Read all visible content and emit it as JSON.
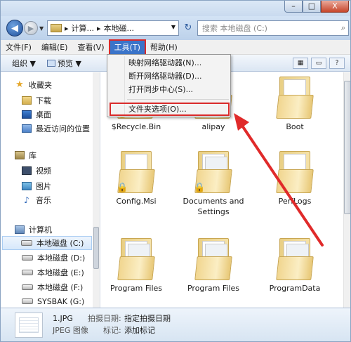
{
  "window": {
    "buttons": {
      "minimize": "–",
      "maximize": "□",
      "close": "X"
    }
  },
  "navigation": {
    "back": "◀",
    "forward": "▶",
    "address_parts": [
      "计算...",
      "本地磁..."
    ],
    "separator": "▸",
    "refresh": "↻",
    "search_placeholder": "搜索 本地磁盘 (C:)",
    "search_icon": "magnifier-icon"
  },
  "menubar": {
    "items": [
      "文件(F)",
      "编辑(E)",
      "查看(V)",
      "工具(T)",
      "帮助(H)"
    ],
    "active_index": 3
  },
  "toolbar": {
    "organize": "组织 ▼",
    "preview": "预览 ▼",
    "views_icon": "▦",
    "help_icon": "?"
  },
  "tools_menu": {
    "items": [
      "映射网络驱动器(N)...",
      "断开网络驱动器(D)...",
      "打开同步中心(S)...",
      "文件夹选项(O)..."
    ],
    "highlighted_index": 3
  },
  "sidebar": {
    "favorites": {
      "label": "收藏夹",
      "items": [
        "下载",
        "桌面",
        "最近访问的位置"
      ]
    },
    "libraries": {
      "label": "库",
      "items": [
        "视频",
        "图片",
        "音乐"
      ]
    },
    "computer": {
      "label": "计算机",
      "drives": [
        "本地磁盘 (C:)",
        "本地磁盘 (D:)",
        "本地磁盘 (E:)",
        "本地磁盘 (F:)",
        "SYSBAK (G:)"
      ],
      "selected_index": 0
    }
  },
  "content": {
    "items": [
      {
        "name": "$Recycle.Bin",
        "locked": true,
        "style": "half"
      },
      {
        "name": "alipay",
        "locked": false,
        "style": "half"
      },
      {
        "name": "Boot",
        "locked": false,
        "style": "paper"
      },
      {
        "name": "Config.Msi",
        "locked": true,
        "style": "paper"
      },
      {
        "name": "Documents and\nSettings",
        "locked": true,
        "style": "paper"
      },
      {
        "name": "PerfLogs",
        "locked": false,
        "style": "paper"
      },
      {
        "name": "Program Files",
        "locked": false,
        "style": "paper"
      },
      {
        "name": "Program Files",
        "locked": false,
        "style": "paper"
      },
      {
        "name": "ProgramData",
        "locked": false,
        "style": "paper"
      }
    ]
  },
  "details": {
    "filename": "1.JPG",
    "filetype": "JPEG 图像",
    "date_label": "拍摄日期:",
    "date_value": "指定拍摄日期",
    "tags_label": "标记:",
    "tags_value": "添加标记"
  },
  "colors": {
    "highlight_red": "#d92a2a",
    "menu_active": "#3b74c9"
  }
}
